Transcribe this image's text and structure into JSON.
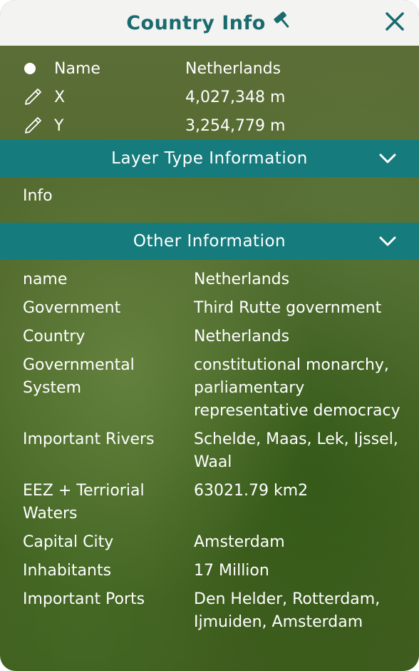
{
  "title": "Country Info",
  "title_icon": "gavel-icon",
  "close_icon": "close-icon",
  "colors": {
    "accent": "#167b7c",
    "title_text": "#1a6b6e",
    "header_bg": "#f3f3f2"
  },
  "coordinates": [
    {
      "icon": "point-icon",
      "label": "Name",
      "value": "Netherlands"
    },
    {
      "icon": "pen-icon",
      "label": "X",
      "value": "4,027,348 m"
    },
    {
      "icon": "pen-icon",
      "label": "Y",
      "value": "3,254,779 m"
    }
  ],
  "layer_section": {
    "label": "Layer Type Information",
    "row": "Info"
  },
  "other_section": {
    "label": "Other Information"
  },
  "properties": [
    {
      "key": "name",
      "value": "Netherlands"
    },
    {
      "key": "Government",
      "value": "Third Rutte government"
    },
    {
      "key": "Country",
      "value": "Netherlands"
    },
    {
      "key": "Governmental System",
      "value": "constitutional monarchy, parliamentary representative democracy"
    },
    {
      "key": "Important Rivers",
      "value": "Schelde, Maas, Lek, Ijssel, Waal"
    },
    {
      "key": "EEZ + Terriorial Waters",
      "value": "63021.79 km2"
    },
    {
      "key": "Capital City",
      "value": "Amsterdam"
    },
    {
      "key": "Inhabitants",
      "value": "17 Million"
    },
    {
      "key": "Important Ports",
      "value": "Den Helder, Rotterdam, Ijmuiden, Amsterdam"
    }
  ]
}
